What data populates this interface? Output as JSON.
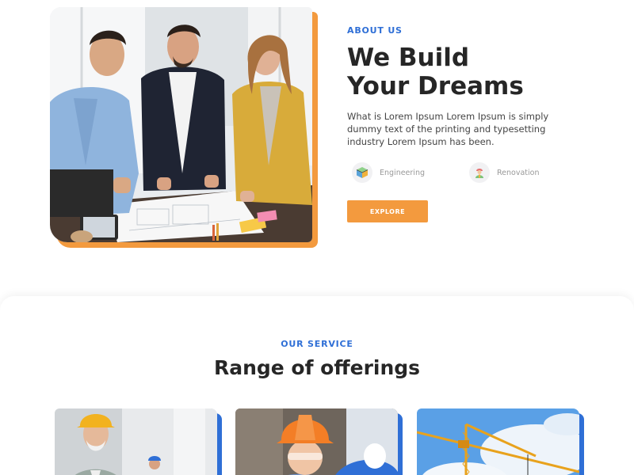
{
  "about": {
    "eyebrow": "ABOUT US",
    "headline_line1": "We Build",
    "headline_line2": "Your Dreams",
    "description": "What is Lorem Ipsum Lorem Ipsum is simply dummy text of the printing and typesetting industry Lorem Ipsum has been.",
    "features": [
      {
        "label": "Engineering",
        "icon": "engineering-cube-icon"
      },
      {
        "label": "Renovation",
        "icon": "renovation-worker-icon"
      }
    ],
    "cta_label": "EXPLORE"
  },
  "services": {
    "eyebrow": "OUR SERVICE",
    "title": "Range of offerings"
  },
  "colors": {
    "accent_orange": "#f39a3e",
    "accent_blue": "#2f6fd6",
    "heading": "#262626"
  }
}
